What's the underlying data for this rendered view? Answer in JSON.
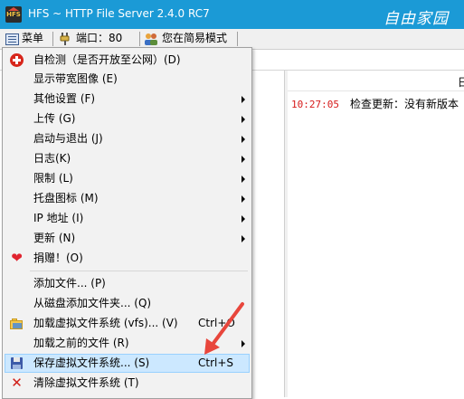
{
  "window": {
    "title": "HFS ~ HTTP File Server 2.4.0 RC7",
    "watermark": "自由家园",
    "app_icon_text": "HFS"
  },
  "toolbar": {
    "menu_label": "菜单",
    "port_label": "端口：80",
    "mode_label": "您在简易模式"
  },
  "log": {
    "header": "日",
    "entries": [
      {
        "time": "10:27:05",
        "message": "检查更新：没有新版本"
      }
    ]
  },
  "menu": {
    "items": [
      {
        "label": "自检测（是否开放至公网）(D)",
        "shortcut": "",
        "submenu": false,
        "icon": "red-cross-icon"
      },
      {
        "label": "显示带宽图像 (E)",
        "shortcut": "",
        "submenu": false,
        "icon": ""
      },
      {
        "label": "其他设置 (F)",
        "shortcut": "",
        "submenu": true,
        "icon": ""
      },
      {
        "label": "上传 (G)",
        "shortcut": "",
        "submenu": true,
        "icon": ""
      },
      {
        "label": "启动与退出 (J)",
        "shortcut": "",
        "submenu": true,
        "icon": ""
      },
      {
        "label": "日志(K)",
        "shortcut": "",
        "submenu": true,
        "icon": ""
      },
      {
        "label": "限制 (L)",
        "shortcut": "",
        "submenu": true,
        "icon": ""
      },
      {
        "label": "托盘图标 (M)",
        "shortcut": "",
        "submenu": true,
        "icon": ""
      },
      {
        "label": "IP 地址 (I)",
        "shortcut": "",
        "submenu": true,
        "icon": ""
      },
      {
        "label": "更新 (N)",
        "shortcut": "",
        "submenu": true,
        "icon": ""
      },
      {
        "label": "捐赠！(O)",
        "shortcut": "",
        "submenu": false,
        "icon": "heart-icon"
      },
      {
        "label": "添加文件... (P)",
        "shortcut": "",
        "submenu": false,
        "icon": ""
      },
      {
        "label": "从磁盘添加文件夹... (Q)",
        "shortcut": "",
        "submenu": false,
        "icon": ""
      },
      {
        "label": "加载虚拟文件系统 (vfs)... (V)",
        "shortcut": "Ctrl+O",
        "submenu": false,
        "icon": "open-folder-icon"
      },
      {
        "label": "加载之前的文件 (R)",
        "shortcut": "",
        "submenu": true,
        "icon": ""
      },
      {
        "label": "保存虚拟文件系统... (S)",
        "shortcut": "Ctrl+S",
        "submenu": false,
        "icon": "floppy-disk-icon",
        "highlighted": true
      },
      {
        "label": "清除虚拟文件系统 (T)",
        "shortcut": "",
        "submenu": false,
        "icon": "red-x-icon"
      }
    ]
  },
  "colors": {
    "titlebar": "#1b9ad6",
    "highlight": "#cce8ff",
    "annotation_arrow": "#e8463c",
    "log_time": "#d61a1a"
  }
}
